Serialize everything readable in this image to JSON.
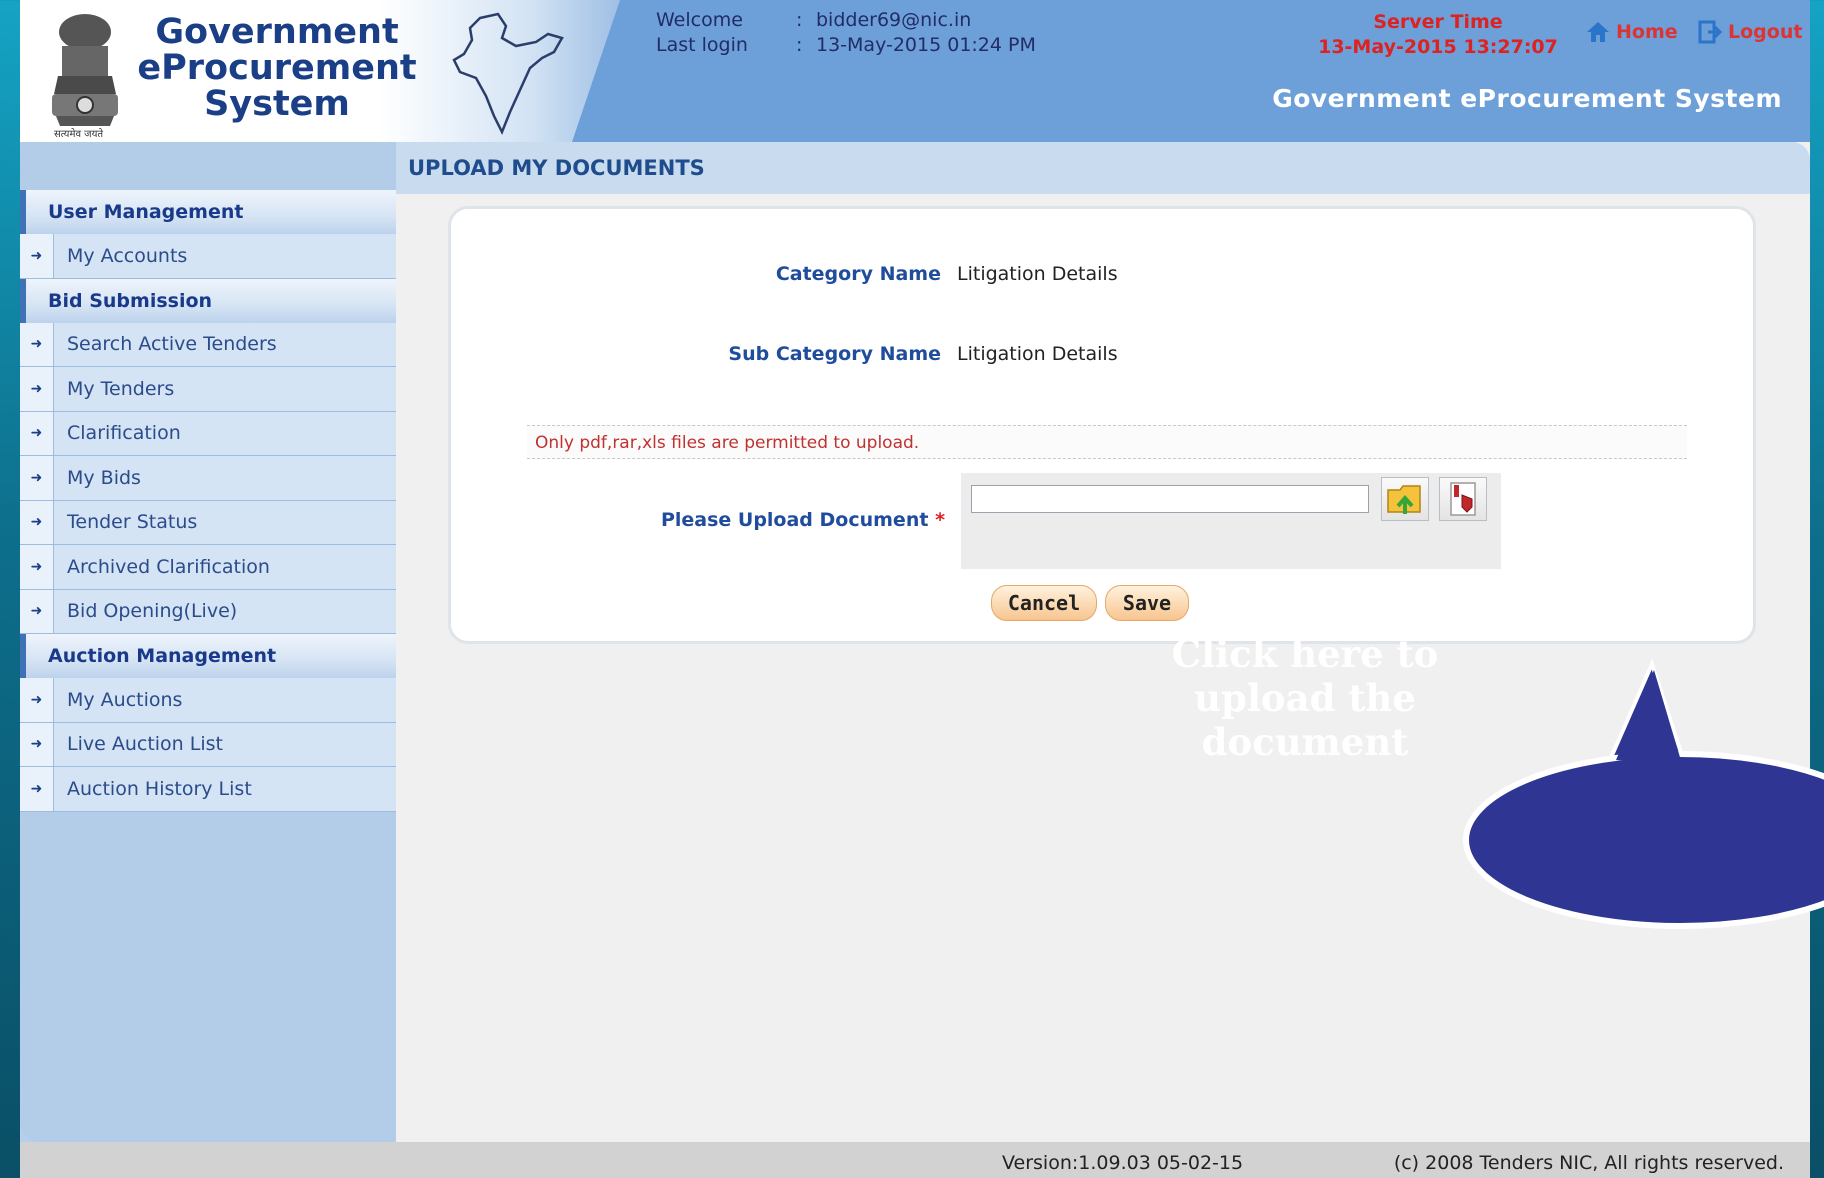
{
  "brand": {
    "line1": "Government",
    "line2": "eProcurement",
    "line3": "System",
    "emblem_caption": "सत्यमेव जयते"
  },
  "session": {
    "welcome_label": "Welcome",
    "welcome_value": "bidder69@nic.in",
    "lastlogin_label": "Last login",
    "lastlogin_value": "13-May-2015 01:24 PM",
    "separator": ":"
  },
  "server_time": {
    "label": "Server Time",
    "value": "13-May-2015 13:27:07"
  },
  "nav": {
    "home": "Home",
    "logout": "Logout"
  },
  "header_title": "Government eProcurement System",
  "sidebar": {
    "sections": [
      {
        "title": "User Management",
        "items": [
          "My Accounts"
        ]
      },
      {
        "title": "Bid Submission",
        "items": [
          "Search Active Tenders",
          "My Tenders",
          "Clarification",
          "My Bids",
          "Tender Status",
          "Archived Clarification",
          "Bid Opening(Live)"
        ]
      },
      {
        "title": "Auction Management",
        "items": [
          "My Auctions",
          "Live Auction List",
          "Auction History List"
        ]
      }
    ]
  },
  "page": {
    "title": "UPLOAD MY DOCUMENTS",
    "category_label": "Category Name",
    "category_value": "Litigation Details",
    "subcategory_label": "Sub Category Name",
    "subcategory_value": "Litigation Details",
    "note": "Only pdf,rar,xls files are permitted to upload.",
    "upload_label": "Please Upload Document",
    "required_mark": "*",
    "upload_value": "",
    "cancel": "Cancel",
    "save": "Save"
  },
  "callout": {
    "line1": "Click here to",
    "line2": "upload the",
    "line3": "document"
  },
  "footer": {
    "version": "Version:1.09.03 05-02-15",
    "copyright": "(c) 2008 Tenders NIC, All rights reserved."
  },
  "colors": {
    "header": "#6d9fd8",
    "sidebar": "#b3cde9",
    "callout": "#2e3592",
    "server_time": "#dd2222"
  }
}
